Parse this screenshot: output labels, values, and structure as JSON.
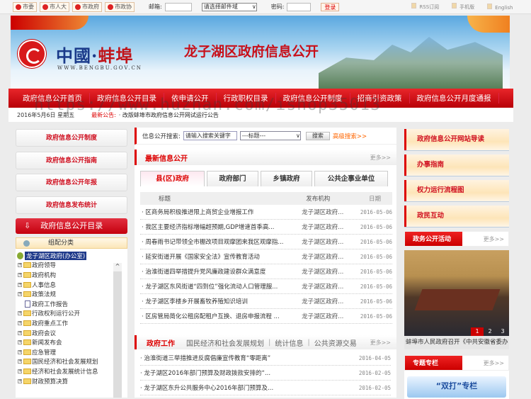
{
  "topbar": {
    "links": [
      "市委",
      "市人大",
      "市政府",
      "市政协"
    ],
    "email_label": "邮箱:",
    "email_domain": "请选择邮件域",
    "password_label": "密码:",
    "login": "登录",
    "rss": "RSS订阅",
    "mobile": "手机版",
    "english": "English"
  },
  "banner": {
    "logo_cn_1": "中國·",
    "logo_cn_2": "蚌埠",
    "logo_url": "WWW.BENGBU.GOV.CN",
    "title": "龙子湖区政府信息公开"
  },
  "nav": [
    "政府信息公开首页",
    "政府信息公开目录",
    "依申请公开",
    "行政职权目录",
    "政府信息公开制度",
    "招商引资政策",
    "政府信息公开月度通报"
  ],
  "datebar": {
    "date": "2016年5月6日 星期五",
    "label": "最新公告:",
    "announcement": "· 改版蚌埠市政府信息公开网试运行公告"
  },
  "watermark": "https://www.huzhan.com/ishop35013",
  "left": {
    "buttons": [
      "政府信息公开制度",
      "政府信息公开指南",
      "政府信息公开年报",
      "政府信息发布统计"
    ],
    "catalog": "政府信息公开目录",
    "category_title": "组配分类",
    "tree_root": "龙子湖区政府(办公室)",
    "tree": [
      {
        "label": "政府领导",
        "type": "folder"
      },
      {
        "label": "政府机构",
        "type": "folder"
      },
      {
        "label": "人事信息",
        "type": "folder"
      },
      {
        "label": "政策法规",
        "type": "folder"
      },
      {
        "label": "政府工作报告",
        "type": "doc"
      },
      {
        "label": "行政权利运行公开",
        "type": "folder"
      },
      {
        "label": "政府重点工作",
        "type": "folder"
      },
      {
        "label": "政府会议",
        "type": "folder"
      },
      {
        "label": "新闻发布会",
        "type": "folder"
      },
      {
        "label": "应急管理",
        "type": "folder"
      },
      {
        "label": "国民经济和社会发展规划",
        "type": "folder"
      },
      {
        "label": "经济和社会发展统计信息",
        "type": "folder"
      },
      {
        "label": "财政预算决算",
        "type": "folder"
      }
    ]
  },
  "middle": {
    "search_label": "信息公开搜索:",
    "search_placeholder": "请输入搜索关键字",
    "search_field": "---标题---",
    "search_btn": "搜索",
    "advanced": "高级搜索>>",
    "latest_title": "最新信息公开",
    "more": "更多>>",
    "tabs": [
      "县(区)政府",
      "政府部门",
      "乡镇政府",
      "公共企事业单位"
    ],
    "columns": [
      "标题",
      "发布机构",
      "日期"
    ],
    "rows": [
      {
        "title": "· 区商务局积极推进限上商贸企业增报工作",
        "org": "龙子湖区政府...",
        "date": "2016-05-06"
      },
      {
        "title": "· 我区主要经济指标增幅超预期,GDP增速首季高...",
        "org": "龙子湖区政府...",
        "date": "2016-05-06"
      },
      {
        "title": "· 周春雨书记带领全市棚改项目观摩团来我区观摩指...",
        "org": "龙子湖区政府...",
        "date": "2016-05-06"
      },
      {
        "title": "· 延安街道开展《国家安全法》宣传教育活动",
        "org": "龙子湖区政府...",
        "date": "2016-05-06"
      },
      {
        "title": "· 治淮街道四举措提升党风廉政建设群众满意度",
        "org": "龙子湖区政府...",
        "date": "2016-05-06"
      },
      {
        "title": "· 龙子湖区东风街道“四到位”强化流动人口管理服...",
        "org": "龙子湖区政府...",
        "date": "2016-05-06"
      },
      {
        "title": "· 龙子湖区李楼乡开展畜牧养殖知识培训",
        "org": "龙子湖区政府...",
        "date": "2016-05-06"
      },
      {
        "title": "· 区房管局简化公租房配租户互换、退房申报流程 ...",
        "org": "龙子湖区政府...",
        "date": "2016-05-06"
      }
    ],
    "work_title": "政府工作",
    "work_tabs": [
      "国民经济和社会发展规划",
      "统计信息",
      "公共资源交易"
    ],
    "work_rows": [
      {
        "title": "· 治淮街道三举措推进反腐倡廉宣传教育“零距离”",
        "date": "2016-04-05"
      },
      {
        "title": "· 龙子湖区2016年部门预算及财政拨款安排的“...",
        "date": "2016-02-05"
      },
      {
        "title": "· 龙子湖区东升公共服务中心2016年部门预算及...",
        "date": "2016-02-05"
      }
    ]
  },
  "right": {
    "buttons": [
      "政府信息公开网站导读",
      "办事指南",
      "权力运行流程图",
      "政民互动"
    ],
    "activity_title": "政务公开活动",
    "more": "更多>>",
    "slides": [
      "1",
      "2",
      "3"
    ],
    "caption": "蚌埠市人民政府召开《中共安徽省委办",
    "topics_title": "专题专栏",
    "topic": "“双打”专栏"
  }
}
